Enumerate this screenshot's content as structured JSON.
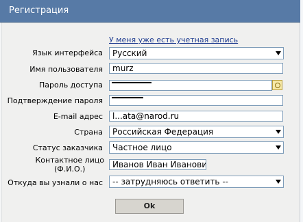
{
  "window": {
    "title": "Регистрация"
  },
  "login_link": "У меня уже есть учетная запись",
  "form": {
    "language": {
      "label": "Язык интерфейса",
      "value": "Русский"
    },
    "username": {
      "label": "Имя пользователя",
      "value": "murz"
    },
    "password": {
      "label": "Пароль доступа",
      "value": "rͥͅ..."
    },
    "password_confirm": {
      "label": "Подтверждение пароля",
      "value": ""
    },
    "email": {
      "label": "E-mail адрес",
      "value": "l...ata@narod.ru"
    },
    "country": {
      "label": "Страна",
      "value": "Российская Федерация"
    },
    "customer_status": {
      "label": "Статус заказчика",
      "value": "Частное лицо"
    },
    "contact_person": {
      "label_line1": "Контактное лицо",
      "label_line2": "(Ф.И.О.)",
      "value": "Иванов Иван Иванович"
    },
    "referral": {
      "label": "Откуда вы узнали о нас",
      "value": "-- затрудняюсь ответить --"
    }
  },
  "buttons": {
    "ok": "Ok"
  },
  "icons": {
    "password_generator": "key-icon"
  }
}
